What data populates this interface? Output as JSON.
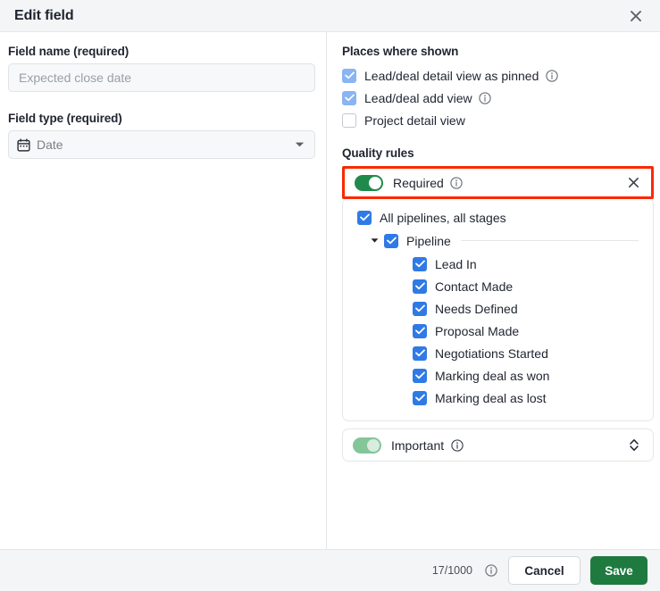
{
  "header": {
    "title": "Edit field",
    "close_icon": "close-icon"
  },
  "left": {
    "field_name_label": "Field name (required)",
    "field_name_value": "",
    "field_name_placeholder": "Expected close date",
    "field_type_label": "Field type (required)",
    "field_type_value": "Date",
    "field_type_icon": "calendar-icon",
    "field_type_caret": "chevron-down-icon"
  },
  "right": {
    "places_title": "Places where shown",
    "places": [
      {
        "label": "Lead/deal detail view as pinned",
        "checked": true,
        "state": "muted",
        "info": true
      },
      {
        "label": "Lead/deal add view",
        "checked": true,
        "state": "muted",
        "info": true
      },
      {
        "label": "Project detail view",
        "checked": false,
        "state": "off",
        "info": false
      }
    ],
    "quality_title": "Quality rules",
    "required_rule": {
      "label": "Required",
      "toggle_on": true,
      "toggle_state": "strong",
      "info": true,
      "remove_icon": "close-icon",
      "highlighted": true
    },
    "all_pipelines": {
      "label": "All pipelines, all stages",
      "checked": true
    },
    "pipeline": {
      "label": "Pipeline",
      "checked": true,
      "expanded": true
    },
    "stages": [
      {
        "label": "Lead In",
        "checked": true
      },
      {
        "label": "Contact Made",
        "checked": true
      },
      {
        "label": "Needs Defined",
        "checked": true
      },
      {
        "label": "Proposal Made",
        "checked": true
      },
      {
        "label": "Negotiations Started",
        "checked": true
      },
      {
        "label": "Marking deal as won",
        "checked": true
      },
      {
        "label": "Marking deal as lost",
        "checked": true
      }
    ],
    "important_rule": {
      "label": "Important",
      "toggle_on": true,
      "toggle_state": "muted",
      "info": true,
      "sorter_icon": "chevron-up-down-icon"
    }
  },
  "footer": {
    "counter": "17/1000",
    "counter_info": true,
    "cancel_label": "Cancel",
    "save_label": "Save"
  },
  "colors": {
    "highlight_red": "#fc2800",
    "toggle_green": "#1f8a4c",
    "toggle_green_muted": "#84c59a",
    "checkbox_blue": "#2f7ae5",
    "checkbox_blue_muted": "#8ab4f2",
    "save_green": "#1f7a3f",
    "header_bg": "#f4f5f6"
  }
}
